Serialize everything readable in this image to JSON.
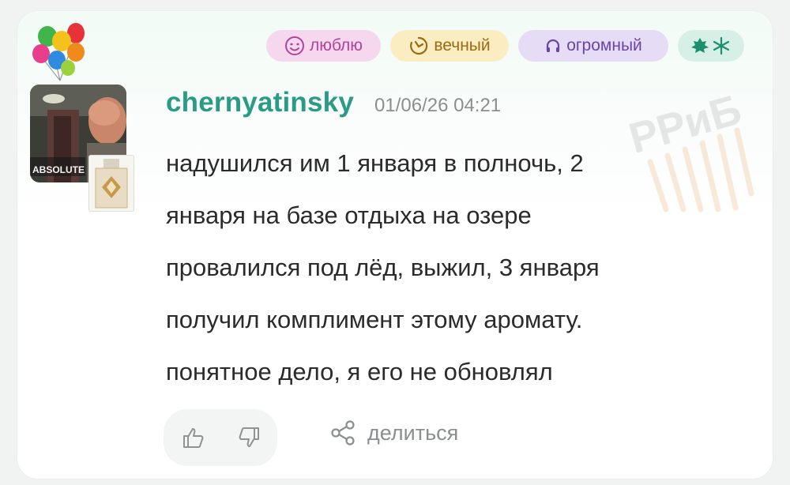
{
  "post": {
    "tags": [
      {
        "label": "люблю",
        "icon": "smiley-heart-icon"
      },
      {
        "label": "вечный",
        "icon": "timer-icon"
      },
      {
        "label": "огромный",
        "icon": "headphones-icon"
      },
      {
        "label": "",
        "icon": "leaf-snowflake-icon"
      }
    ],
    "username": "chernyatinsky",
    "timestamp": "01/06/26 04:21",
    "avatar_caption": "ABSOLUTE",
    "text_lines": [
      "надушился им 1 января в полночь, 2",
      "января на базе отдыха на озере",
      "провалился под лёд, выжил, 3 января",
      "получил комплимент этому аромату.",
      "понятное дело, я его не обновлял"
    ],
    "share_label": "делиться",
    "watermark": "РРиБ"
  },
  "colors": {
    "username": "#2a9b85",
    "love_bg": "#f6d8ee",
    "eternal_bg": "#fbedc2",
    "huge_bg": "#e6dcf5",
    "icons_bg": "#d6f0e8"
  }
}
